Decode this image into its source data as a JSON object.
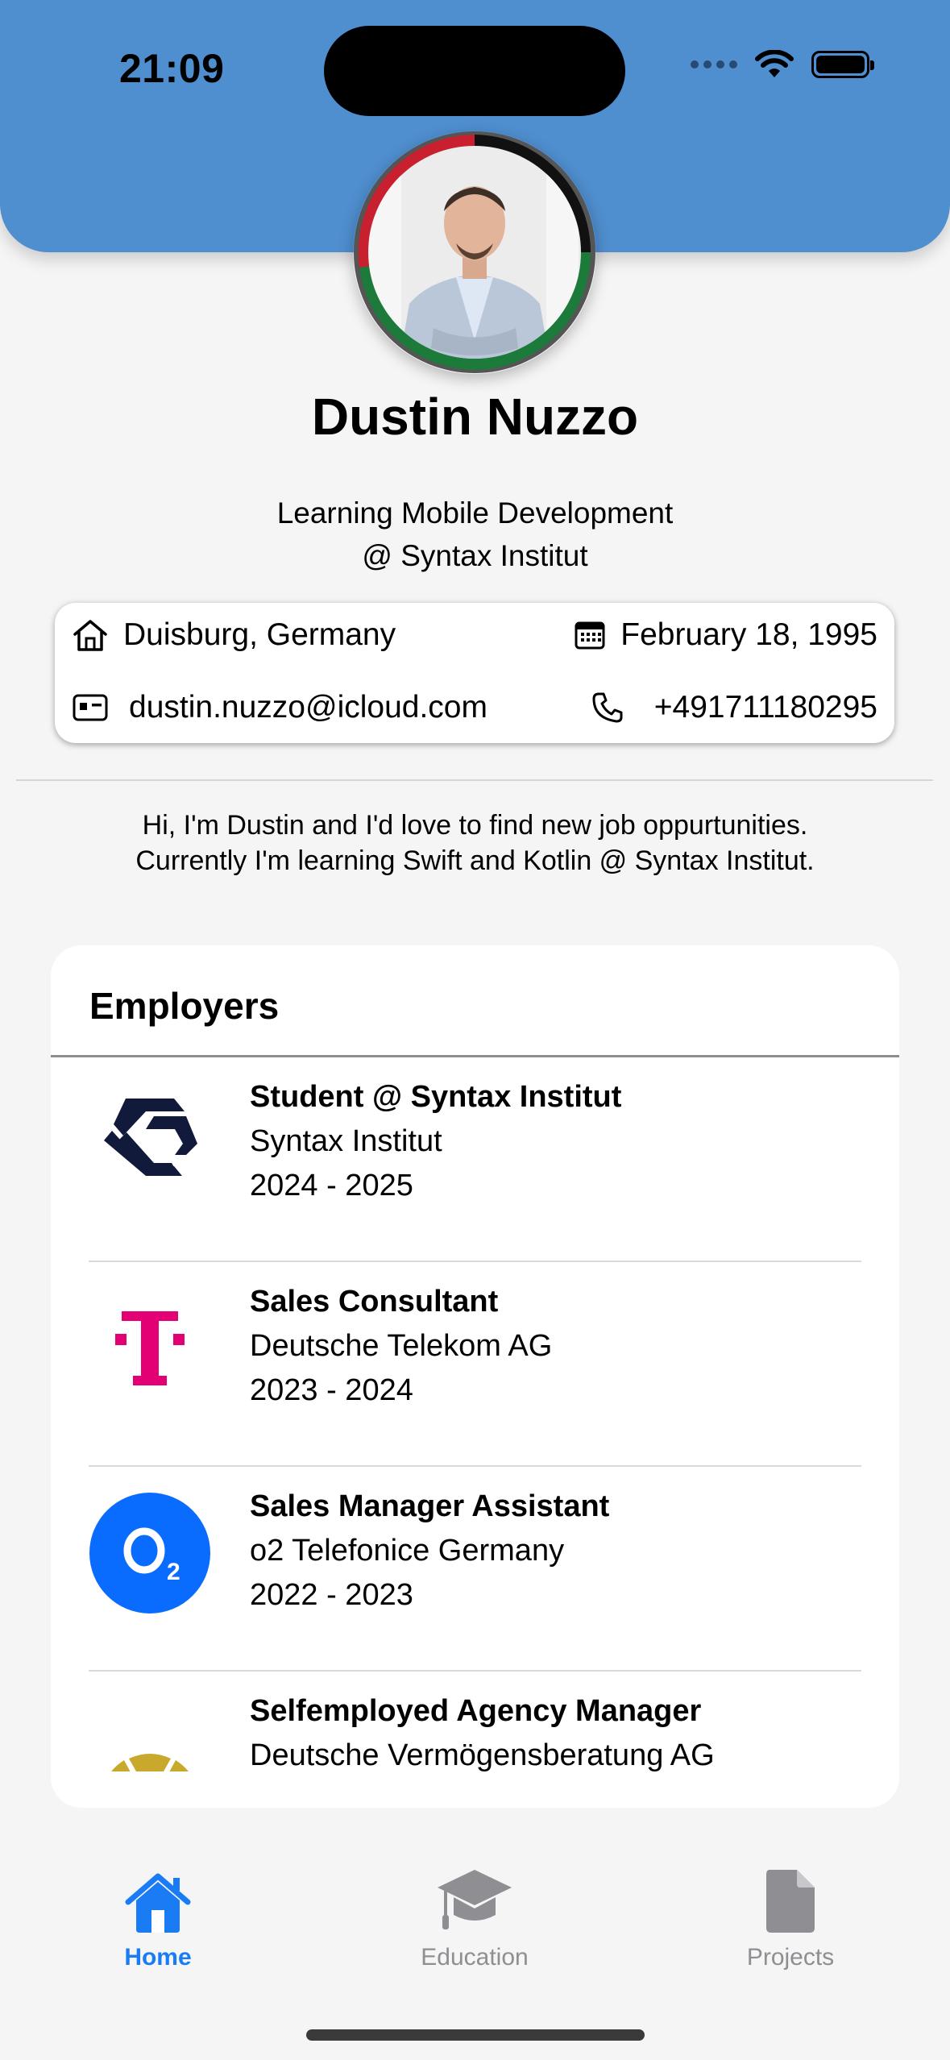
{
  "status_bar": {
    "time": "21:09"
  },
  "profile": {
    "name": "Dustin Nuzzo",
    "subtitle_line1": "Learning Mobile Development",
    "subtitle_line2": "@ Syntax Institut"
  },
  "info": {
    "location": "Duisburg, Germany",
    "birthday": "February 18, 1995",
    "email": "dustin.nuzzo@icloud.com",
    "phone": "+491711180295"
  },
  "bio": {
    "line1": "Hi, I'm Dustin and I'd love to find new job oppurtunities.",
    "line2": "Currently I'm learning Swift and Kotlin @ Syntax Institut."
  },
  "employers": {
    "title": "Employers",
    "items": [
      {
        "role": "Student @ Syntax Institut",
        "company": "Syntax Institut",
        "years": "2024 - 2025",
        "logo": "syntax-logo"
      },
      {
        "role": "Sales Consultant",
        "company": "Deutsche Telekom AG",
        "years": "2023 - 2024",
        "logo": "telekom-logo"
      },
      {
        "role": "Sales Manager Assistant",
        "company": "o2 Telefonice Germany",
        "years": "2022 - 2023",
        "logo": "o2-logo"
      },
      {
        "role": "Selfemployed Agency Manager",
        "company": "Deutsche Vermögensberatung AG",
        "years": "",
        "logo": "dvag-logo"
      }
    ]
  },
  "tabs": [
    {
      "label": "Home",
      "icon": "house-icon",
      "active": true
    },
    {
      "label": "Education",
      "icon": "graduation-cap-icon",
      "active": false
    },
    {
      "label": "Projects",
      "icon": "document-icon",
      "active": false
    }
  ],
  "colors": {
    "header": "#4f8ecf",
    "accent": "#1a7cf5",
    "inactive_tab": "#8e8e93",
    "telekom": "#e20074",
    "o2": "#0a6cff",
    "syntax": "#111a3a",
    "dvag": "#c9a92c"
  }
}
